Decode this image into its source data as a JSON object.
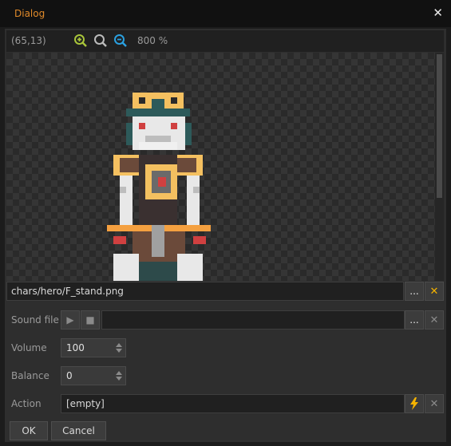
{
  "window": {
    "title": "Dialog",
    "close_icon": "close-icon"
  },
  "viewer": {
    "coords": "(65,13)",
    "zoom_level": "800 %",
    "zoom_in_icon": "zoom-in-icon",
    "zoom_reset_icon": "zoom-reset-icon",
    "zoom_out_icon": "zoom-out-icon",
    "image_path": "chars/hero/F_stand.png"
  },
  "form": {
    "sound_label": "Sound file",
    "sound_value": "",
    "volume_label": "Volume",
    "volume_value": "100",
    "balance_label": "Balance",
    "balance_value": "0",
    "action_label": "Action",
    "action_value": "[empty]"
  },
  "buttons": {
    "ok": "OK",
    "cancel": "Cancel",
    "browse": "..."
  },
  "colors": {
    "title_accent": "#e08a2a",
    "clear_accent": "#f5b300",
    "zoom_in": "#a8c43a",
    "zoom_out": "#2aa0e0"
  }
}
